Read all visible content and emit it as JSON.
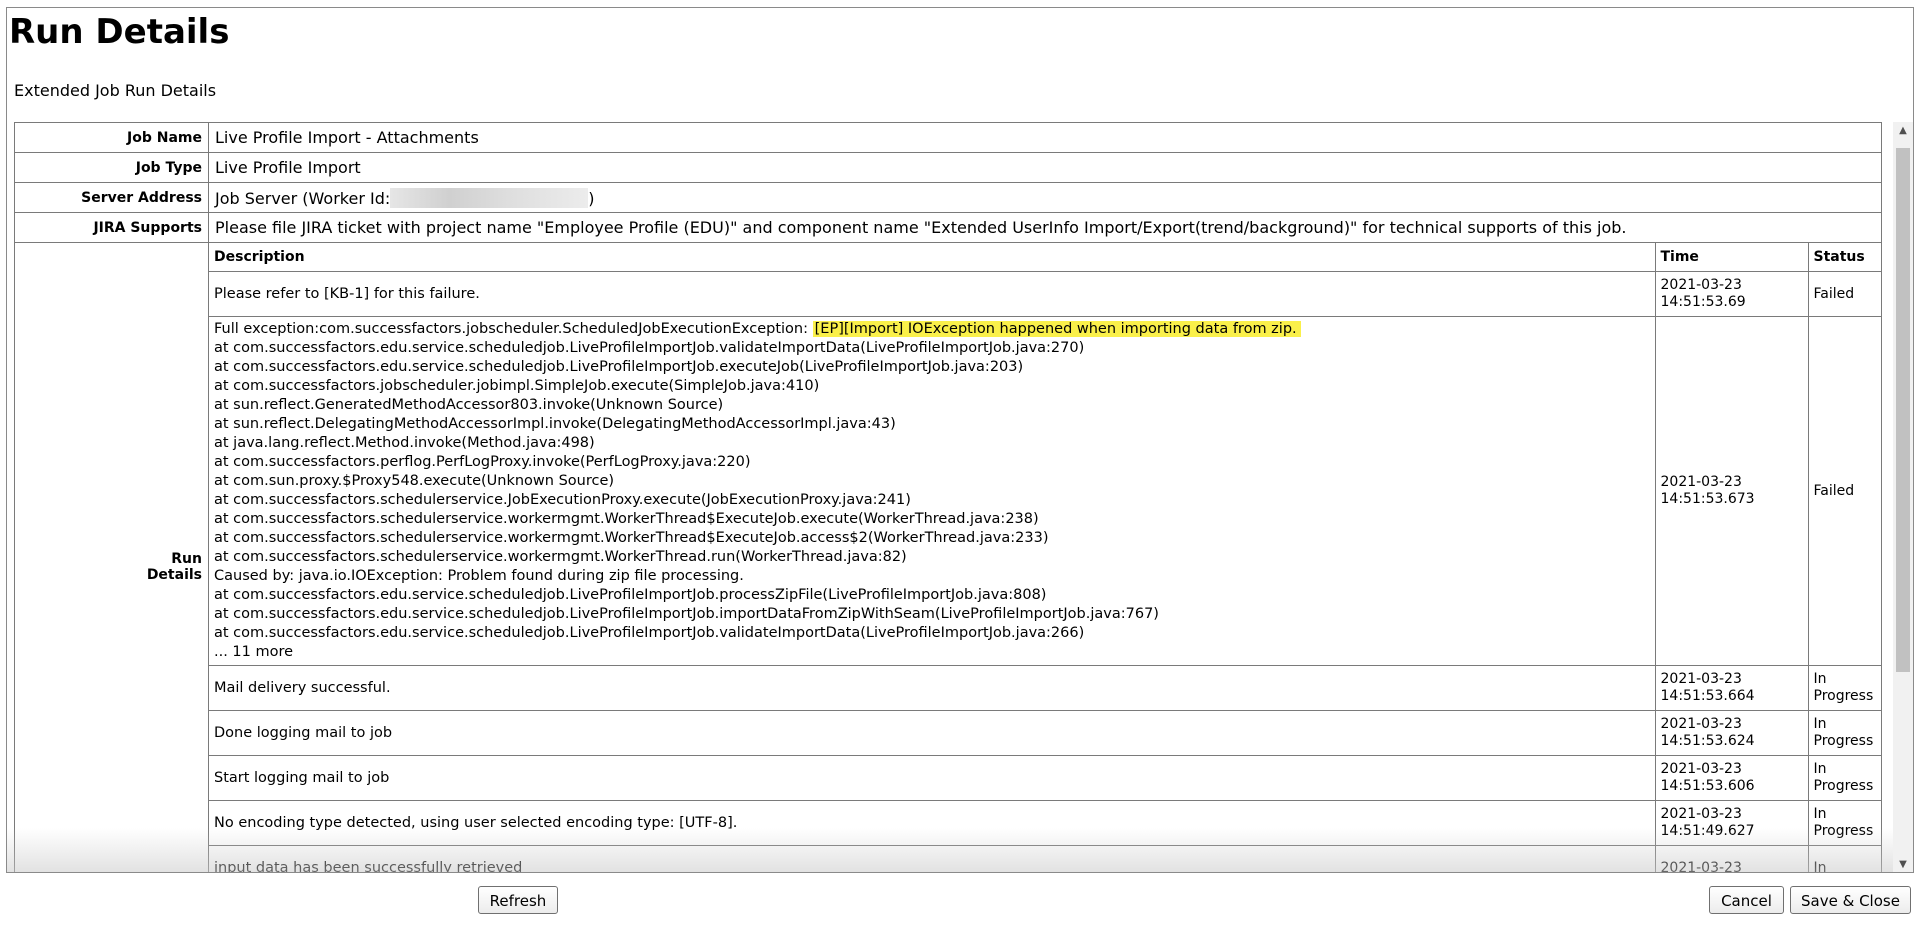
{
  "page": {
    "title": "Run Details",
    "subtitle": "Extended Job Run Details"
  },
  "fields": {
    "job_name": {
      "label": "Job Name",
      "value": "Live Profile Import - Attachments"
    },
    "job_type": {
      "label": "Job Type",
      "value": "Live Profile Import"
    },
    "server_address": {
      "label": "Server Address",
      "prefix": "Job Server (Worker Id:",
      "suffix": ")"
    },
    "jira": {
      "label": "JIRA Supports",
      "value": "Please file JIRA ticket with project name \"Employee Profile (EDU)\" and component name \"Extended UserInfo Import/Export(trend/background)\" for technical supports of this job."
    },
    "run_details_label_1": "Run",
    "run_details_label_2": "Details"
  },
  "runs": {
    "headers": {
      "description": "Description",
      "time": "Time",
      "status": "Status"
    },
    "rows": [
      {
        "description": "Please refer to [KB-1] for this failure.",
        "date": "2021-03-23",
        "time": "14:51:53.69",
        "status": "Failed"
      },
      {
        "description_prefix": "Full exception:com.successfactors.jobscheduler.ScheduledJobExecutionException: ",
        "description_highlight": "[EP][Import] IOException happened when importing data from zip.",
        "trace": [
          "at com.successfactors.edu.service.scheduledjob.LiveProfileImportJob.validateImportData(LiveProfileImportJob.java:270)",
          "at com.successfactors.edu.service.scheduledjob.LiveProfileImportJob.executeJob(LiveProfileImportJob.java:203)",
          "at com.successfactors.jobscheduler.jobimpl.SimpleJob.execute(SimpleJob.java:410)",
          "at sun.reflect.GeneratedMethodAccessor803.invoke(Unknown Source)",
          "at sun.reflect.DelegatingMethodAccessorImpl.invoke(DelegatingMethodAccessorImpl.java:43)",
          "at java.lang.reflect.Method.invoke(Method.java:498)",
          "at com.successfactors.perflog.PerfLogProxy.invoke(PerfLogProxy.java:220)",
          "at com.sun.proxy.$Proxy548.execute(Unknown Source)",
          "at com.successfactors.schedulerservice.JobExecutionProxy.execute(JobExecutionProxy.java:241)",
          "at com.successfactors.schedulerservice.workermgmt.WorkerThread$ExecuteJob.execute(WorkerThread.java:238)",
          "at com.successfactors.schedulerservice.workermgmt.WorkerThread$ExecuteJob.access$2(WorkerThread.java:233)",
          "at com.successfactors.schedulerservice.workermgmt.WorkerThread.run(WorkerThread.java:82)",
          "Caused by: java.io.IOException: Problem found during zip file processing.",
          "at com.successfactors.edu.service.scheduledjob.LiveProfileImportJob.processZipFile(LiveProfileImportJob.java:808)",
          "at com.successfactors.edu.service.scheduledjob.LiveProfileImportJob.importDataFromZipWithSeam(LiveProfileImportJob.java:767)",
          "at com.successfactors.edu.service.scheduledjob.LiveProfileImportJob.validateImportData(LiveProfileImportJob.java:266)",
          "... 11 more"
        ],
        "date": "2021-03-23",
        "time": "14:51:53.673",
        "status": "Failed"
      },
      {
        "description": "Mail delivery successful.",
        "date": "2021-03-23",
        "time": "14:51:53.664",
        "status_1": "In",
        "status_2": "Progress"
      },
      {
        "description": "Done logging mail to job",
        "date": "2021-03-23",
        "time": "14:51:53.624",
        "status_1": "In",
        "status_2": "Progress"
      },
      {
        "description": "Start logging mail to job",
        "date": "2021-03-23",
        "time": "14:51:53.606",
        "status_1": "In",
        "status_2": "Progress"
      },
      {
        "description": "No encoding type detected, using user selected encoding type: [UTF-8].",
        "date": "2021-03-23",
        "time": "14:51:49.627",
        "status_1": "In",
        "status_2": "Progress"
      },
      {
        "description": "input data has been successfully retrieved",
        "date": "2021-03-23",
        "status_1": "In"
      }
    ]
  },
  "buttons": {
    "refresh": "Refresh",
    "cancel": "Cancel",
    "save_close": "Save & Close"
  },
  "icons": {
    "scroll_up": "triangle-up-icon",
    "scroll_down": "triangle-down-icon"
  },
  "colors": {
    "highlight": "#faf04a",
    "border": "#7a7a7a"
  }
}
